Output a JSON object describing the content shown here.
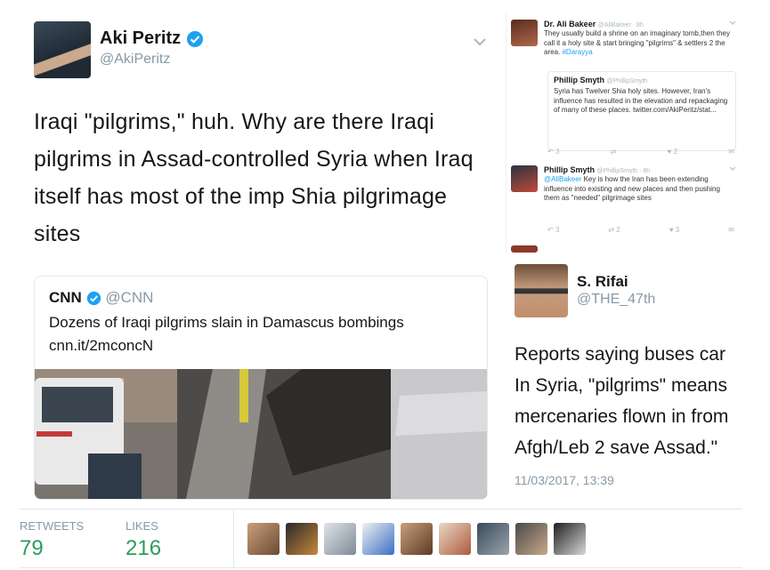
{
  "main_tweet": {
    "name": "Aki Peritz",
    "handle": "@AkiPeritz",
    "text": "Iraqi \"pilgrims,\" huh. Why are there Iraqi pilgrims in Assad-controlled Syria when Iraq itself has most of the imp Shia pilgrimage sites",
    "menu_icon": "chevron-down-icon"
  },
  "card": {
    "name": "CNN",
    "handle": "@CNN",
    "headline": "Dozens of Iraqi pilgrims slain in Damascus bombings",
    "link": "cnn.it/2mconcN"
  },
  "thread": {
    "tweet1": {
      "name": "Dr. Ali Bakeer",
      "handle": "@AliBakeer · 8h",
      "text": "They usually build a shrine on an imaginary tomb,then they call it a holy site & start bringing \"pilgrims\" & settlers 2 the area.",
      "hashtag": "#Darayya",
      "quote_name": "Phillip Smyth",
      "quote_handle": "@PhillipSmyth",
      "quote_text": "Syria has Twelver Shia holy sites. However, Iran's influence has resulted in the elevation and repackaging of many of these places. twitter.com/AkiPeritz/stat...",
      "actions": {
        "reply": "3",
        "retweet": "",
        "like": "2"
      }
    },
    "tweet2": {
      "name": "Phillip Smyth",
      "handle": "@PhillipSmyth · 8h",
      "mention": "@AliBakeer",
      "text": "Key is how the Iran has been extending influence into existing and new places and then pushing them as \"needed\" pilgrimage sites",
      "actions": {
        "reply": "3",
        "retweet": "2",
        "like": "3"
      }
    }
  },
  "rifai": {
    "name": "S. Rifai",
    "handle": "@THE_47th",
    "lines": [
      "Reports saying buses car",
      "In Syria, \"pilgrims\" means",
      "mercenaries flown in from",
      "Afgh/Leb 2 save Assad.\""
    ],
    "timestamp": "11/03/2017, 13:39"
  },
  "stats": {
    "retweets_label": "RETWEETS",
    "retweets": "79",
    "likes_label": "LIKES",
    "likes": "216"
  },
  "colors": {
    "verified": "#1da1f2",
    "stat_value": "#2a9d5c",
    "muted": "#8899a6",
    "hashtag": "#1da1f2"
  }
}
